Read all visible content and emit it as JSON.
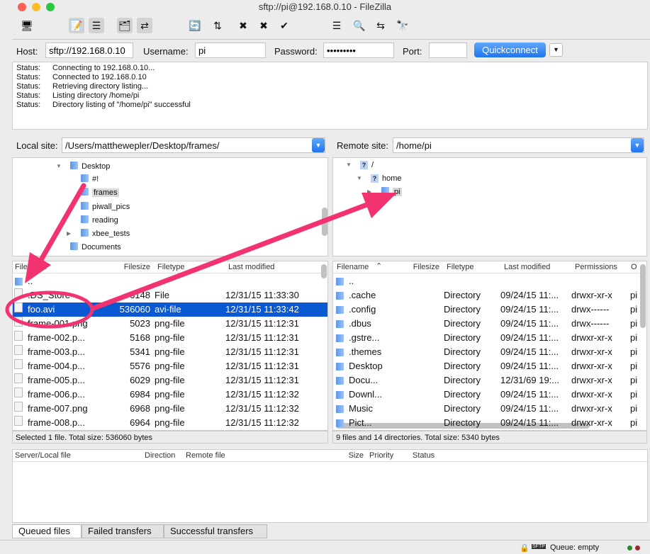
{
  "window": {
    "title": "sftp://pi@192.168.0.10 - FileZilla"
  },
  "toolbar": {
    "icons": [
      "site-manager-icon",
      "message-log-icon",
      "local-tree-icon",
      "remote-tree-icon",
      "transfer-queue-icon",
      "refresh-icon",
      "process-queue-icon",
      "cancel-icon",
      "disconnect-icon",
      "reconnect-icon",
      "filter-icon",
      "compare-icon",
      "sync-browse-icon",
      "search-icon"
    ]
  },
  "quickconnect": {
    "host_label": "Host:",
    "host": "sftp://192.168.0.10",
    "username_label": "Username:",
    "username": "pi",
    "password_label": "Password:",
    "password": "•••••••••",
    "port_label": "Port:",
    "port": "",
    "button": "Quickconnect",
    "dropdown": "▼"
  },
  "log": [
    {
      "type": "Status:",
      "msg": "Connecting to 192.168.0.10..."
    },
    {
      "type": "Status:",
      "msg": "Connected to 192.168.0.10"
    },
    {
      "type": "Status:",
      "msg": "Retrieving directory listing..."
    },
    {
      "type": "Status:",
      "msg": "Listing directory /home/pi"
    },
    {
      "type": "Status:",
      "msg": "Directory listing of \"/home/pi\" successful"
    }
  ],
  "local": {
    "site_label": "Local site:",
    "path": "/Users/matthewepler/Desktop/frames/",
    "tree": [
      "Desktop",
      "#!",
      "frames",
      "piwall_pics",
      "reading",
      "xbee_tests",
      "Documents"
    ],
    "columns": [
      "Filename",
      "Filesize",
      "Filetype",
      "Last modified"
    ],
    "files": [
      {
        "name": "..",
        "size": "",
        "type": "",
        "modified": ""
      },
      {
        "name": ".DS_Store",
        "size": "6148",
        "type": "File",
        "modified": "12/31/15 11:33:30"
      },
      {
        "name": "foo.avi",
        "size": "536060",
        "type": "avi-file",
        "modified": "12/31/15 11:33:42",
        "selected": true
      },
      {
        "name": "frame-001.png",
        "size": "5023",
        "type": "png-file",
        "modified": "12/31/15 11:12:31"
      },
      {
        "name": "frame-002.p...",
        "size": "5168",
        "type": "png-file",
        "modified": "12/31/15 11:12:31"
      },
      {
        "name": "frame-003.p...",
        "size": "5341",
        "type": "png-file",
        "modified": "12/31/15 11:12:31"
      },
      {
        "name": "frame-004.p...",
        "size": "5576",
        "type": "png-file",
        "modified": "12/31/15 11:12:31"
      },
      {
        "name": "frame-005.p...",
        "size": "6029",
        "type": "png-file",
        "modified": "12/31/15 11:12:31"
      },
      {
        "name": "frame-006.p...",
        "size": "6984",
        "type": "png-file",
        "modified": "12/31/15 11:12:32"
      },
      {
        "name": "frame-007.png",
        "size": "6968",
        "type": "png-file",
        "modified": "12/31/15 11:12:32"
      },
      {
        "name": "frame-008.p...",
        "size": "6964",
        "type": "png-file",
        "modified": "12/31/15 11:12:32"
      }
    ],
    "status": "Selected 1 file. Total size: 536060 bytes"
  },
  "remote": {
    "site_label": "Remote site:",
    "path": "/home/pi",
    "tree": [
      "/",
      "home",
      "pi"
    ],
    "columns": [
      "Filename",
      "Filesize",
      "Filetype",
      "Last modified",
      "Permissions",
      "O"
    ],
    "files": [
      {
        "name": "..",
        "size": "",
        "type": "",
        "modified": "",
        "perms": "",
        "owner": ""
      },
      {
        "name": ".cache",
        "size": "",
        "type": "Directory",
        "modified": "09/24/15 11:...",
        "perms": "drwxr-xr-x",
        "owner": "pi"
      },
      {
        "name": ".config",
        "size": "",
        "type": "Directory",
        "modified": "09/24/15 11:...",
        "perms": "drwx------",
        "owner": "pi"
      },
      {
        "name": ".dbus",
        "size": "",
        "type": "Directory",
        "modified": "09/24/15 11:...",
        "perms": "drwx------",
        "owner": "pi"
      },
      {
        "name": ".gstre...",
        "size": "",
        "type": "Directory",
        "modified": "09/24/15 11:...",
        "perms": "drwxr-xr-x",
        "owner": "pi"
      },
      {
        "name": ".themes",
        "size": "",
        "type": "Directory",
        "modified": "09/24/15 11:...",
        "perms": "drwxr-xr-x",
        "owner": "pi"
      },
      {
        "name": "Desktop",
        "size": "",
        "type": "Directory",
        "modified": "09/24/15 11:...",
        "perms": "drwxr-xr-x",
        "owner": "pi"
      },
      {
        "name": "Docu...",
        "size": "",
        "type": "Directory",
        "modified": "12/31/69 19:...",
        "perms": "drwxr-xr-x",
        "owner": "pi"
      },
      {
        "name": "Downl...",
        "size": "",
        "type": "Directory",
        "modified": "09/24/15 11:...",
        "perms": "drwxr-xr-x",
        "owner": "pi"
      },
      {
        "name": "Music",
        "size": "",
        "type": "Directory",
        "modified": "09/24/15 11:...",
        "perms": "drwxr-xr-x",
        "owner": "pi"
      },
      {
        "name": "Pict...",
        "size": "",
        "type": "Directory",
        "modified": "09/24/15 11:...",
        "perms": "drwxr-xr-x",
        "owner": "pi"
      }
    ],
    "status": "9 files and 14 directories. Total size: 5340 bytes"
  },
  "queue": {
    "columns": [
      "Server/Local file",
      "Direction",
      "Remote file",
      "Size",
      "Priority",
      "Status"
    ],
    "tabs": [
      "Queued files",
      "Failed transfers",
      "Successful transfers"
    ]
  },
  "statusbar": {
    "queue": "Queue: empty",
    "sftp_badge": "SFTP"
  },
  "colors": {
    "selection": "#0a59d2",
    "annotation": "#f2336f",
    "accent": "#1f74f0"
  }
}
